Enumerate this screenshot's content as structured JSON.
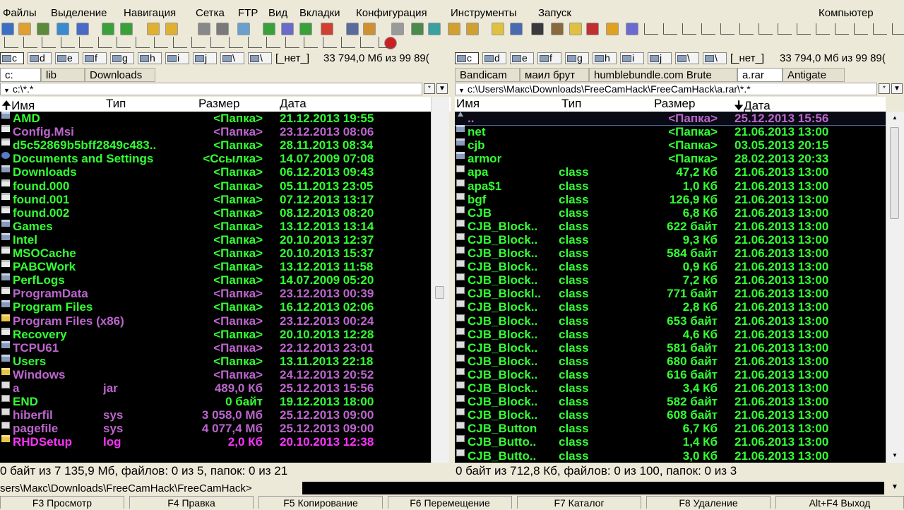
{
  "menu": {
    "items": [
      "Файлы",
      "Выделение",
      "Навигация",
      "Сетка",
      "FTP",
      "Вид",
      "Вкладки",
      "Конфигурация",
      "Инструменты",
      "Запуск"
    ],
    "right": "Компьютер"
  },
  "toolbar": {
    "icons": [
      "grid-icon",
      "folder-icon",
      "film-icon",
      "globe-icon",
      "shield-icon",
      "back-icon",
      "forward-icon",
      "folder-open-icon",
      "folder-open-icon",
      "wrench-icon",
      "settings-icon",
      "image-icon",
      "refresh-icon",
      "filter-icon",
      "check-icon",
      "undo-icon",
      "eye-icon",
      "tree-icon",
      "copy-icon",
      "panel-icon",
      "merge-icon",
      "lock-icon",
      "unlock-icon",
      "archive-icon",
      "search-icon",
      "traffic-light-icon",
      "edit-icon",
      "notes-icon",
      "res-icon",
      "smile-icon",
      "disc-icon",
      "stop-icon"
    ]
  },
  "left": {
    "drives": [
      "c",
      "d",
      "e",
      "f",
      "g",
      "h",
      "i",
      "j",
      "\\",
      "\\"
    ],
    "active_drive": "c",
    "disk_label": "[_нет_]",
    "disk_info": "33 794,0 Мб из 99 89(",
    "tabs": [
      "c:",
      "lib",
      "Downloads"
    ],
    "active_tab": 0,
    "path": "c:\\*.*",
    "headers": {
      "name": "Имя",
      "type": "Тип",
      "size": "Размер",
      "date": "Дата"
    },
    "rows": [
      {
        "name": "AMD",
        "ext": "",
        "size": "<Папка>",
        "date": "21.12.2013 19:55",
        "color": "#33ff33",
        "icon": "folder"
      },
      {
        "name": "Config.Msi",
        "ext": "",
        "size": "<Папка>",
        "date": "23.12.2013 08:06",
        "color": "#bb66cc",
        "icon": "hidden"
      },
      {
        "name": "d5c52869b5bff2849c483..",
        "ext": "",
        "size": "<Папка>",
        "date": "28.11.2013 08:34",
        "color": "#33ff33",
        "icon": "hidden"
      },
      {
        "name": "Documents and Settings",
        "ext": "",
        "size": "<Ссылка>",
        "date": "14.07.2009 07:08",
        "color": "#33ff33",
        "icon": "link"
      },
      {
        "name": "Downloads",
        "ext": "",
        "size": "<Папка>",
        "date": "06.12.2013 09:43",
        "color": "#33ff33",
        "icon": "folder"
      },
      {
        "name": "found.000",
        "ext": "",
        "size": "<Папка>",
        "date": "05.11.2013 23:05",
        "color": "#33ff33",
        "icon": "hidden"
      },
      {
        "name": "found.001",
        "ext": "",
        "size": "<Папка>",
        "date": "07.12.2013 13:17",
        "color": "#33ff33",
        "icon": "hidden"
      },
      {
        "name": "found.002",
        "ext": "",
        "size": "<Папка>",
        "date": "08.12.2013 08:20",
        "color": "#33ff33",
        "icon": "hidden"
      },
      {
        "name": "Games",
        "ext": "",
        "size": "<Папка>",
        "date": "13.12.2013 13:14",
        "color": "#33ff33",
        "icon": "folder"
      },
      {
        "name": "Intel",
        "ext": "",
        "size": "<Папка>",
        "date": "20.10.2013 12:37",
        "color": "#33ff33",
        "icon": "folder"
      },
      {
        "name": "MSOCache",
        "ext": "",
        "size": "<Папка>",
        "date": "20.10.2013 15:37",
        "color": "#33ff33",
        "icon": "hidden"
      },
      {
        "name": "PABCWork",
        "ext": "",
        "size": "<Папка>",
        "date": "13.12.2013 11:58",
        "color": "#33ff33",
        "icon": "hidden"
      },
      {
        "name": "PerfLogs",
        "ext": "",
        "size": "<Папка>",
        "date": "14.07.2009 05:20",
        "color": "#33ff33",
        "icon": "folder"
      },
      {
        "name": "ProgramData",
        "ext": "",
        "size": "<Папка>",
        "date": "23.12.2013 00:39",
        "color": "#bb66cc",
        "icon": "hidden"
      },
      {
        "name": "Program Files",
        "ext": "",
        "size": "<Папка>",
        "date": "16.12.2013 02:06",
        "color": "#33ff33",
        "icon": "folder"
      },
      {
        "name": "Program Files (x86)",
        "ext": "",
        "size": "<Папка>",
        "date": "23.12.2013 00:24",
        "color": "#bb66cc",
        "icon": "yellow"
      },
      {
        "name": "Recovery",
        "ext": "",
        "size": "<Папка>",
        "date": "20.10.2013 12:28",
        "color": "#33ff33",
        "icon": "hidden"
      },
      {
        "name": "TCPU61",
        "ext": "",
        "size": "<Папка>",
        "date": "22.12.2013 23:01",
        "color": "#bb66cc",
        "icon": "folder"
      },
      {
        "name": "Users",
        "ext": "",
        "size": "<Папка>",
        "date": "13.11.2013 22:18",
        "color": "#33ff33",
        "icon": "folder"
      },
      {
        "name": "Windows",
        "ext": "",
        "size": "<Папка>",
        "date": "24.12.2013 20:52",
        "color": "#bb66cc",
        "icon": "yellow"
      },
      {
        "name": "a",
        "ext": "jar",
        "size": "489,0 Кб",
        "date": "25.12.2013 15:56",
        "color": "#bb66cc",
        "icon": "file"
      },
      {
        "name": "END",
        "ext": "",
        "size": "0 байт",
        "date": "19.12.2013 18:00",
        "color": "#33ff33",
        "icon": "file"
      },
      {
        "name": "hiberfil",
        "ext": "sys",
        "size": "3 058,0 Мб",
        "date": "25.12.2013 09:00",
        "color": "#bb66cc",
        "icon": "file"
      },
      {
        "name": "pagefile",
        "ext": "sys",
        "size": "4 077,4 Мб",
        "date": "25.12.2013 09:00",
        "color": "#bb66cc",
        "icon": "file"
      },
      {
        "name": "RHDSetup",
        "ext": "log",
        "size": "2,0 Кб",
        "date": "20.10.2013 12:38",
        "color": "#ff33ff",
        "icon": "yellow"
      }
    ],
    "status": "0 байт из 7 135,9 Мб, файлов: 0 из 5, папок: 0 из 21"
  },
  "right": {
    "drives": [
      "c",
      "d",
      "e",
      "f",
      "g",
      "h",
      "i",
      "j",
      "\\",
      "\\"
    ],
    "active_drive": "c",
    "disk_label": "[_нет_]",
    "disk_info": "33 794,0 Мб из 99 89(",
    "tabs": [
      "Bandicam",
      "маил брут",
      "humblebundle.com Brute",
      "a.rar",
      "Antigate"
    ],
    "active_tab": 3,
    "path": "c:\\Users\\Макс\\Downloads\\FreeCamHack\\FreeCamHack\\a.rar\\*.*",
    "headers": {
      "name": "Имя",
      "type": "Тип",
      "size": "Размер",
      "date": "Дата"
    },
    "rows": [
      {
        "name": "..",
        "ext": "",
        "size": "<Папка>",
        "date": "25.12.2013 15:56",
        "color": "#bb66cc",
        "icon": "up",
        "selected": true
      },
      {
        "name": "net",
        "ext": "",
        "size": "<Папка>",
        "date": "21.06.2013 13:00",
        "color": "#33ff33",
        "icon": "folder"
      },
      {
        "name": "cjb",
        "ext": "",
        "size": "<Папка>",
        "date": "03.05.2013 20:15",
        "color": "#33ff33",
        "icon": "folder"
      },
      {
        "name": "armor",
        "ext": "",
        "size": "<Папка>",
        "date": "28.02.2013 20:33",
        "color": "#33ff33",
        "icon": "folder"
      },
      {
        "name": "apa",
        "ext": "class",
        "size": "47,2 Кб",
        "date": "21.06.2013 13:00",
        "color": "#33ff33",
        "icon": "file"
      },
      {
        "name": "apa$1",
        "ext": "class",
        "size": "1,0 Кб",
        "date": "21.06.2013 13:00",
        "color": "#33ff33",
        "icon": "file"
      },
      {
        "name": "bgf",
        "ext": "class",
        "size": "126,9 Кб",
        "date": "21.06.2013 13:00",
        "color": "#33ff33",
        "icon": "file"
      },
      {
        "name": "CJB",
        "ext": "class",
        "size": "6,8 Кб",
        "date": "21.06.2013 13:00",
        "color": "#33ff33",
        "icon": "file"
      },
      {
        "name": "CJB_Block..",
        "ext": "class",
        "size": "622 байт",
        "date": "21.06.2013 13:00",
        "color": "#33ff33",
        "icon": "file"
      },
      {
        "name": "CJB_Block..",
        "ext": "class",
        "size": "9,3 Кб",
        "date": "21.06.2013 13:00",
        "color": "#33ff33",
        "icon": "file"
      },
      {
        "name": "CJB_Block..",
        "ext": "class",
        "size": "584 байт",
        "date": "21.06.2013 13:00",
        "color": "#33ff33",
        "icon": "file"
      },
      {
        "name": "CJB_Block..",
        "ext": "class",
        "size": "0,9 Кб",
        "date": "21.06.2013 13:00",
        "color": "#33ff33",
        "icon": "file"
      },
      {
        "name": "CJB_Block..",
        "ext": "class",
        "size": "7,2 Кб",
        "date": "21.06.2013 13:00",
        "color": "#33ff33",
        "icon": "file"
      },
      {
        "name": "CJB_Blockl..",
        "ext": "class",
        "size": "771 байт",
        "date": "21.06.2013 13:00",
        "color": "#33ff33",
        "icon": "file"
      },
      {
        "name": "CJB_Block..",
        "ext": "class",
        "size": "2,8 Кб",
        "date": "21.06.2013 13:00",
        "color": "#33ff33",
        "icon": "file"
      },
      {
        "name": "CJB_Block..",
        "ext": "class",
        "size": "653 байт",
        "date": "21.06.2013 13:00",
        "color": "#33ff33",
        "icon": "file"
      },
      {
        "name": "CJB_Block..",
        "ext": "class",
        "size": "4,6 Кб",
        "date": "21.06.2013 13:00",
        "color": "#33ff33",
        "icon": "file"
      },
      {
        "name": "CJB_Block..",
        "ext": "class",
        "size": "581 байт",
        "date": "21.06.2013 13:00",
        "color": "#33ff33",
        "icon": "file"
      },
      {
        "name": "CJB_Block..",
        "ext": "class",
        "size": "680 байт",
        "date": "21.06.2013 13:00",
        "color": "#33ff33",
        "icon": "file"
      },
      {
        "name": "CJB_Block..",
        "ext": "class",
        "size": "616 байт",
        "date": "21.06.2013 13:00",
        "color": "#33ff33",
        "icon": "file"
      },
      {
        "name": "CJB_Block..",
        "ext": "class",
        "size": "3,4 Кб",
        "date": "21.06.2013 13:00",
        "color": "#33ff33",
        "icon": "file"
      },
      {
        "name": "CJB_Block..",
        "ext": "class",
        "size": "582 байт",
        "date": "21.06.2013 13:00",
        "color": "#33ff33",
        "icon": "file"
      },
      {
        "name": "CJB_Block..",
        "ext": "class",
        "size": "608 байт",
        "date": "21.06.2013 13:00",
        "color": "#33ff33",
        "icon": "file"
      },
      {
        "name": "CJB_Button",
        "ext": "class",
        "size": "6,7 Кб",
        "date": "21.06.2013 13:00",
        "color": "#33ff33",
        "icon": "file"
      },
      {
        "name": "CJB_Butto..",
        "ext": "class",
        "size": "1,4 Кб",
        "date": "21.06.2013 13:00",
        "color": "#33ff33",
        "icon": "file"
      },
      {
        "name": "CJB_Butto..",
        "ext": "class",
        "size": "3,0 Кб",
        "date": "21.06.2013 13:00",
        "color": "#33ff33",
        "icon": "file"
      }
    ],
    "status": "0 байт из 712,8 Кб, файлов: 0 из 100, папок: 0 из 3"
  },
  "cmdline": {
    "prompt": "sers\\Макс\\Downloads\\FreeCamHack\\FreeCamHack>"
  },
  "fkeys": [
    "F3 Просмотр",
    "F4 Правка",
    "F5 Копирование",
    "F6 Перемещение",
    "F7 Каталог",
    "F8 Удаление",
    "Alt+F4 Выход"
  ],
  "colors": {
    "folder": "#33ff33",
    "hidden": "#bb66cc",
    "log": "#ff33ff",
    "panel_bg": "#000000",
    "chrome_bg": "#ece9d8"
  }
}
